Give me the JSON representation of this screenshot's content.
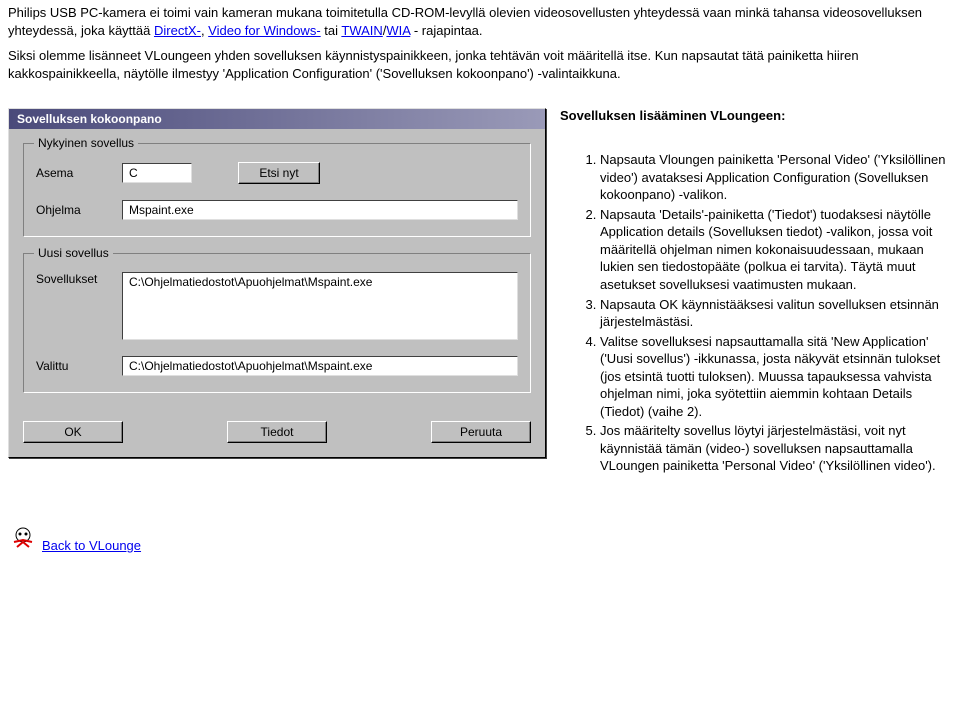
{
  "intro": {
    "p1_pre": "Philips USB PC-kamera ei toimi vain kameran mukana toimitetulla CD-ROM-levyllä olevien videosovellusten yhteydessä vaan minkä tahansa videosovelluksen yhteydessä, joka käyttää ",
    "links": {
      "directx": "DirectX-",
      "vfw": "Video for Windows-",
      "twain": "TWAIN",
      "wia": "WIA"
    },
    "p1_mid1": ", ",
    "p1_mid2": " tai ",
    "p1_slash": "/",
    "p1_post": " - rajapintaa.",
    "p2": "Siksi olemme lisänneet VLoungeen yhden sovelluksen käynnistyspainikkeen, jonka tehtävän voit määritellä itse. Kun napsautat tätä painiketta hiiren kakkospainikkeella, näytölle ilmestyy 'Application Configuration' ('Sovelluksen kokoonpano') -valintaikkuna."
  },
  "dialog": {
    "title": "Sovelluksen kokoonpano",
    "group_current": "Nykyinen sovellus",
    "label_asema": "Asema",
    "value_asema": "C",
    "btn_etsi": "Etsi nyt",
    "label_ohjelma": "Ohjelma",
    "value_ohjelma": "Mspaint.exe",
    "group_new": "Uusi sovellus",
    "label_sovellukket": "Sovellukset",
    "list_item": "C:\\Ohjelmatiedostot\\Apuohjelmat\\Mspaint.exe",
    "label_valittu": "Valittu",
    "value_valittu": "C:\\Ohjelmatiedostot\\Apuohjelmat\\Mspaint.exe",
    "btn_ok": "OK",
    "btn_tiedot": "Tiedot",
    "btn_peruuta": "Peruuta"
  },
  "right": {
    "heading": "Sovelluksen lisääminen VLoungeen:",
    "items": [
      "Napsauta Vloungen painiketta 'Personal Video' ('Yksilöllinen video') avataksesi Application Configuration (Sovelluksen kokoonpano) -valikon.",
      "Napsauta 'Details'-painiketta ('Tiedot') tuodaksesi näytölle Application details (Sovelluksen tiedot) -valikon, jossa voit määritellä ohjelman nimen kokonai­suudessaan, mukaan lukien sen tiedostopääte (polkua ei tarvita). Täytä muut asetukset sovelluksesi vaatimusten mukaan.",
      "Napsauta OK käynnistääksesi valitun sovelluksen etsinnän järjestelmästäsi.",
      "Valitse sovelluksesi napsauttamalla sitä 'New Application' ('Uusi sovellus') -ikkunassa, josta näkyvät etsinnän tulokset (jos etsintä tuotti tuloksen). Muussa tapauksessa vahvista ohjelman nimi, joka syötettiin aiemmin kohtaan Details (Tiedot) (vaihe 2).",
      "Jos määritelty sovellus löytyi järjestelmästäsi, voit nyt käynnistää tämän (video-) sovelluksen napsauttamalla VLoungen painiketta 'Personal Video' ('Yksilöllinen video')."
    ]
  },
  "back_label": "Back to VLounge"
}
